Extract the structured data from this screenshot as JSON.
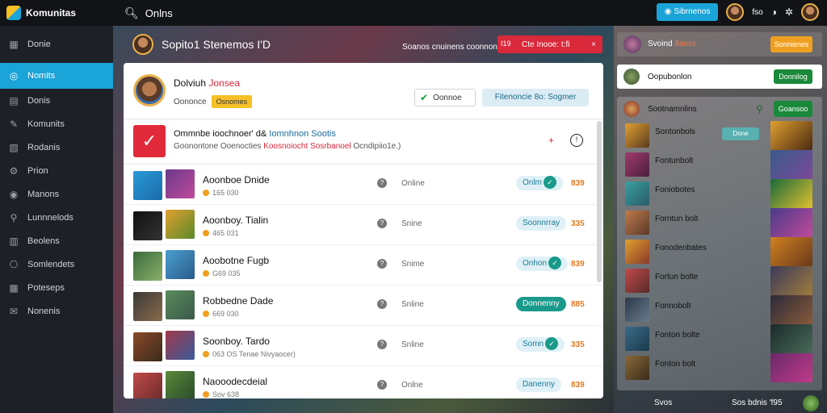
{
  "topbar": {
    "app_name": "Komunitas",
    "search_label": "Onlns",
    "primary_button": "Sibrnenos",
    "user_label": "fso",
    "help_icon": "help-icon",
    "settings_icon": "settings-icon"
  },
  "sidebar": {
    "items": [
      {
        "label": "Donie",
        "icon": "▦"
      },
      {
        "label": "Nomits",
        "icon": "◎"
      },
      {
        "label": "Donis",
        "icon": "▤"
      },
      {
        "label": "Komunits",
        "icon": "✎"
      },
      {
        "label": "Rodanis",
        "icon": "▧"
      },
      {
        "label": "Prion",
        "icon": "⚙"
      },
      {
        "label": "Manons",
        "icon": "◉"
      },
      {
        "label": "Lunnnelods",
        "icon": "⚲"
      },
      {
        "label": "Beolens",
        "icon": "▥"
      },
      {
        "label": "Somlendets",
        "icon": "⎔"
      },
      {
        "label": "Poteseps",
        "icon": "▦"
      },
      {
        "label": "Nonenis",
        "icon": "✉"
      }
    ]
  },
  "hero": {
    "title": "Sopito1 Stenemos I'D",
    "subtitle": "Soanos cnuinens coonnonio",
    "alert": "Cte Inooe: t:fi",
    "alert_close": "×",
    "alert_num": "I19"
  },
  "profile": {
    "name": "Dolviuh",
    "name_red": "Jonsea",
    "desc": "Oononce",
    "badge": "Osnomes",
    "btn_outline": "Oonnoe",
    "btn_light": "Fitenoncie 8o: Sogmer"
  },
  "notice": {
    "title": "Ommnbe ioochnoer' d& ",
    "title_blue": "Iomnhnon Sootis",
    "text": "Goonontone Ooenocties ",
    "text_red": "Koosnoiocht Sosrbanoel",
    "text_end": " Ocndipiio1e.)"
  },
  "rows": [
    {
      "title": "Aoonboe Dnide",
      "meta": "165 030",
      "status": "Online",
      "badge": "Onlm",
      "num": "839",
      "t1": "linear-gradient(135deg,#2a9ad8,#1a6aa8)",
      "t2": "linear-gradient(135deg,#6a3a8a,#c04a9a)"
    },
    {
      "title": "Aoonboy. Tialin",
      "meta": "465 031",
      "status": "Snine",
      "badge": "Soonnrray",
      "num": "335",
      "t1": "linear-gradient(135deg,#111,#333)",
      "t2": "linear-gradient(135deg,#e0a030,#5a8a2a)"
    },
    {
      "title": "Aoobotne Fugb",
      "meta": "G69 035",
      "status": "Snime",
      "badge": "Onhon",
      "num": "839",
      "t1": "linear-gradient(135deg,#3a6a3a,#8ab06a)",
      "t2": "linear-gradient(135deg,#4aa0d0,#2a5a8a)"
    },
    {
      "title": "Robbedne Dade",
      "meta": "669 030",
      "status": "Snline",
      "badge": "Donnenny",
      "num": "885",
      "t1": "linear-gradient(135deg,#3a3a3a,#8a6a4a)",
      "t2": "linear-gradient(135deg,#5a8a5a,#3a5a4a)"
    },
    {
      "title": "Soonboy. Tardo",
      "meta": "063 OS Tenae Nivyaocer)",
      "status": "Snline",
      "badge": "Somn",
      "num": "335",
      "t1": "linear-gradient(135deg,#8a4a2a,#3a2a1a)",
      "t2": "linear-gradient(135deg,#a03a4a,#3a5a9a)"
    },
    {
      "title": "Naooodecdeial",
      "meta": "Sov 638",
      "status": "Onlne",
      "badge": "Danenny",
      "num": "839",
      "t1": "linear-gradient(135deg,#c04a4a,#6a2a2a)",
      "t2": "linear-gradient(135deg,#5a8a3a,#2a4a2a)"
    }
  ],
  "right": {
    "top_text": "Svoind ",
    "top_text_red": "8anss",
    "top_btn": "Sonnienes",
    "white_text": "Oopubonlon",
    "white_btn": "Donnilog",
    "list_title": "Sootnamnlins",
    "list_btn": "Goansoo",
    "items": [
      {
        "title": "Sontonbols",
        "sub": "",
        "tag": "Done",
        "sq": "linear-gradient(135deg,#e0a030,#5a3a20)",
        "art": "linear-gradient(135deg,#e0a030,#4a2a10)"
      },
      {
        "title": "Fontunbolt",
        "sub": "",
        "tag": "",
        "sq": "linear-gradient(135deg,#a03a6a,#4a2040)",
        "art": "linear-gradient(135deg,#3a5a8a,#7a4a9a)"
      },
      {
        "title": "Foniobotes",
        "sub": "",
        "tag": "",
        "sq": "linear-gradient(135deg,#3aa0a0,#2a5a6a)",
        "art": "linear-gradient(135deg,#1a6a3a,#e0c030)"
      },
      {
        "title": "Forntun bolt",
        "sub": "",
        "tag": "",
        "sq": "linear-gradient(135deg,#c07a4a,#5a3a2a)",
        "art": "linear-gradient(135deg,#4a3a8a,#c04a9a)"
      },
      {
        "title": "Fonodenbates",
        "sub": "",
        "tag": "",
        "sq": "linear-gradient(135deg,#e0a030,#8a3a2a)",
        "art": "linear-gradient(135deg,#d08020,#6a3a1a)"
      },
      {
        "title": "Fortun bolte",
        "sub": "",
        "tag": "",
        "sq": "linear-gradient(135deg,#c04a4a,#5a2a2a)",
        "art": "linear-gradient(135deg,#3a3a5a,#a07a3a)"
      },
      {
        "title": "Fonnobolt",
        "sub": "",
        "tag": "",
        "sq": "linear-gradient(135deg,#2a3a4a,#6a7a8a)",
        "art": "linear-gradient(135deg,#2a2a3a,#8a5a3a)"
      },
      {
        "title": "Fonton bolte",
        "sub": "",
        "tag": "",
        "sq": "linear-gradient(135deg,#3a6a8a,#1a3a4a)",
        "art": "linear-gradient(135deg,#1a2a2a,#4a6a5a)"
      },
      {
        "title": "Fonton bolt",
        "sub": "",
        "tag": "",
        "sq": "linear-gradient(135deg,#8a6a3a,#3a2a1a)",
        "art": "linear-gradient(135deg,#6a2a6a,#c03a8a)"
      }
    ],
    "footer1": "Svos",
    "footer2": "Sos bdnis 'f95"
  },
  "bottom": {
    "text": "Sov 638"
  }
}
